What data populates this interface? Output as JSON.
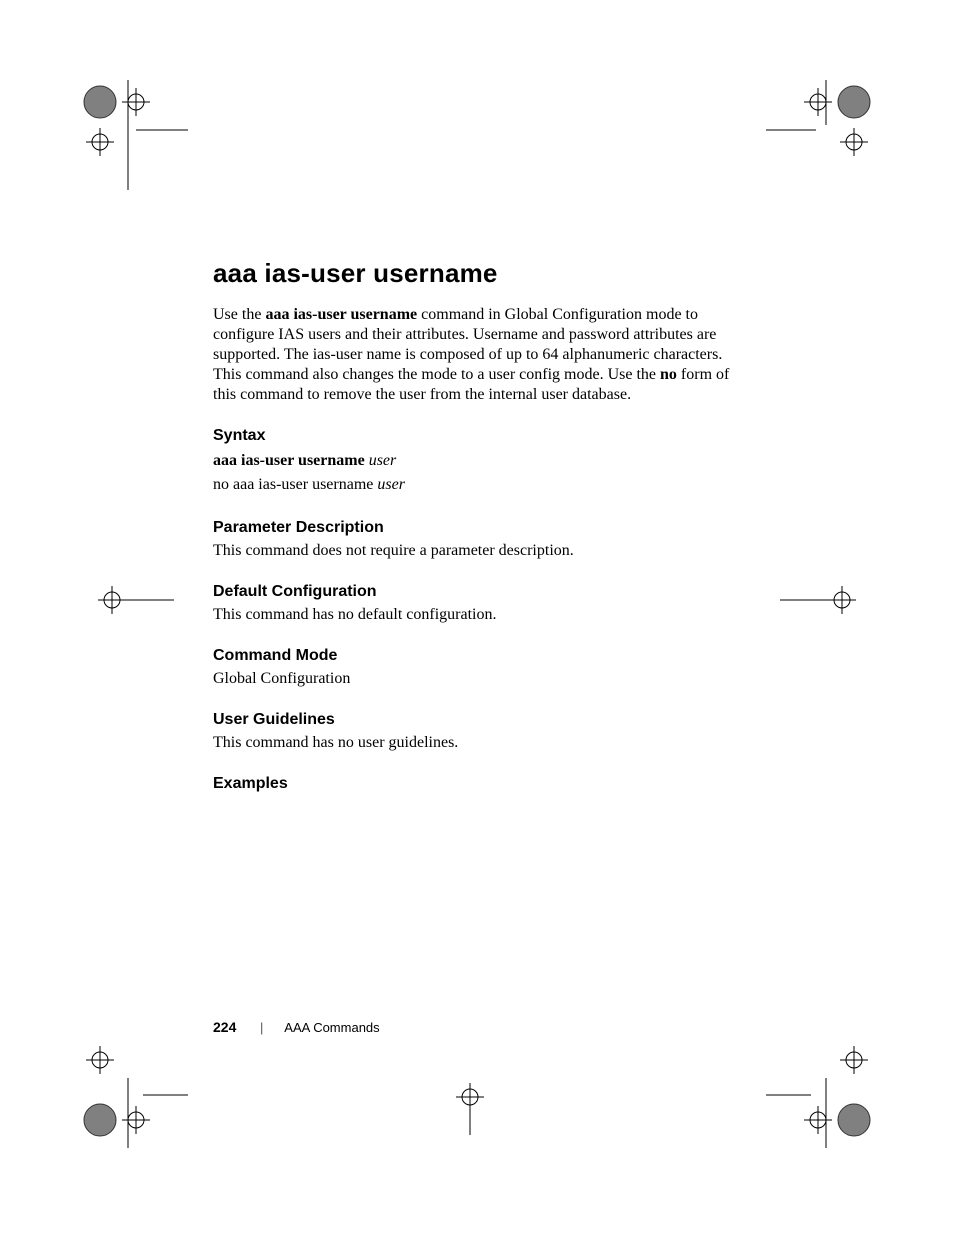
{
  "title": "aaa ias-user username",
  "intro": {
    "pre1": "Use the ",
    "bold1": "aaa ias-user username",
    "mid1": " command in Global Configuration mode to configure IAS users and their attributes. Username and password attributes are supported. The ias-user name is composed of up to 64 alphanumeric characters. This command also changes the mode to a user config mode. Use the ",
    "bold2": "no",
    "post1": " form of this command to remove the user from the internal user database."
  },
  "sections": {
    "syntax": {
      "heading": "Syntax",
      "line1_bold": "aaa ias-user username",
      "line1_ital": "user",
      "line2_plain": "no aaa ias-user username",
      "line2_ital": "user"
    },
    "param": {
      "heading": "Parameter Description",
      "body": "This command does not require a parameter description."
    },
    "default": {
      "heading": "Default Configuration",
      "body": "This command has no default configuration."
    },
    "mode": {
      "heading": "Command Mode",
      "body": "Global Configuration"
    },
    "guidelines": {
      "heading": "User Guidelines",
      "body": "This command has no user guidelines."
    },
    "examples": {
      "heading": "Examples"
    }
  },
  "footer": {
    "page_number": "224",
    "section": "AAA Commands"
  }
}
